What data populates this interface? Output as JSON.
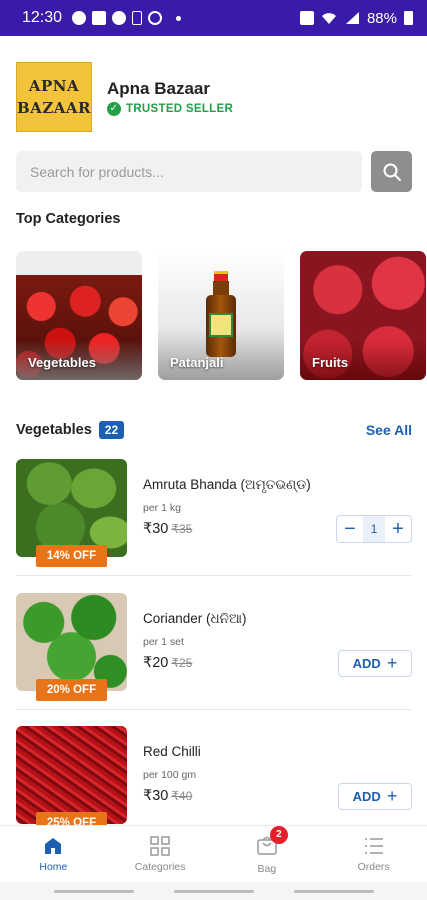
{
  "status_bar": {
    "time": "12:30",
    "battery": "88%",
    "icons": [
      "whatsapp-icon",
      "chat-icon",
      "app-icon",
      "data-icon",
      "payment-icon",
      "alarm-icon",
      "wifi-icon",
      "signal-icon",
      "battery-icon"
    ]
  },
  "store": {
    "logo_line1": "APNA",
    "logo_line2": "BAZAAR",
    "name": "Apna Bazaar",
    "badge": "TRUSTED SELLER"
  },
  "search": {
    "placeholder": "Search for products..."
  },
  "top_categories": {
    "title": "Top Categories",
    "items": [
      {
        "label": "Vegetables"
      },
      {
        "label": "Patanjali"
      },
      {
        "label": "Fruits"
      }
    ]
  },
  "vegetables_section": {
    "title": "Vegetables",
    "count": "22",
    "see_all": "See All"
  },
  "products": [
    {
      "name": "Amruta Bhanda (ଅମୃତଭଣ୍ଡ)",
      "unit": "per 1 kg",
      "price": "₹30",
      "mrp": "₹35",
      "discount": "14% OFF",
      "quantity": "1",
      "in_cart": true
    },
    {
      "name": "Coriander (ଧନିଆ)",
      "unit": "per 1 set",
      "price": "₹20",
      "mrp": "₹25",
      "discount": "20% OFF",
      "add_label": "ADD",
      "in_cart": false
    },
    {
      "name": "Red Chilli",
      "unit": "per 100 gm",
      "price": "₹30",
      "mrp": "₹40",
      "discount": "25% OFF",
      "add_label": "ADD",
      "in_cart": false
    }
  ],
  "bottom_nav": {
    "items": [
      {
        "label": "Home",
        "icon": "home-icon",
        "active": true
      },
      {
        "label": "Categories",
        "icon": "grid-icon",
        "active": false
      },
      {
        "label": "Bag",
        "icon": "bag-icon",
        "active": false,
        "badge": "2"
      },
      {
        "label": "Orders",
        "icon": "list-icon",
        "active": false
      }
    ]
  },
  "colors": {
    "status_bar": "#3a1aa8",
    "primary": "#1d5fb0",
    "trusted": "#22a046",
    "discount": "#e8741a",
    "badge": "#e5202b"
  }
}
